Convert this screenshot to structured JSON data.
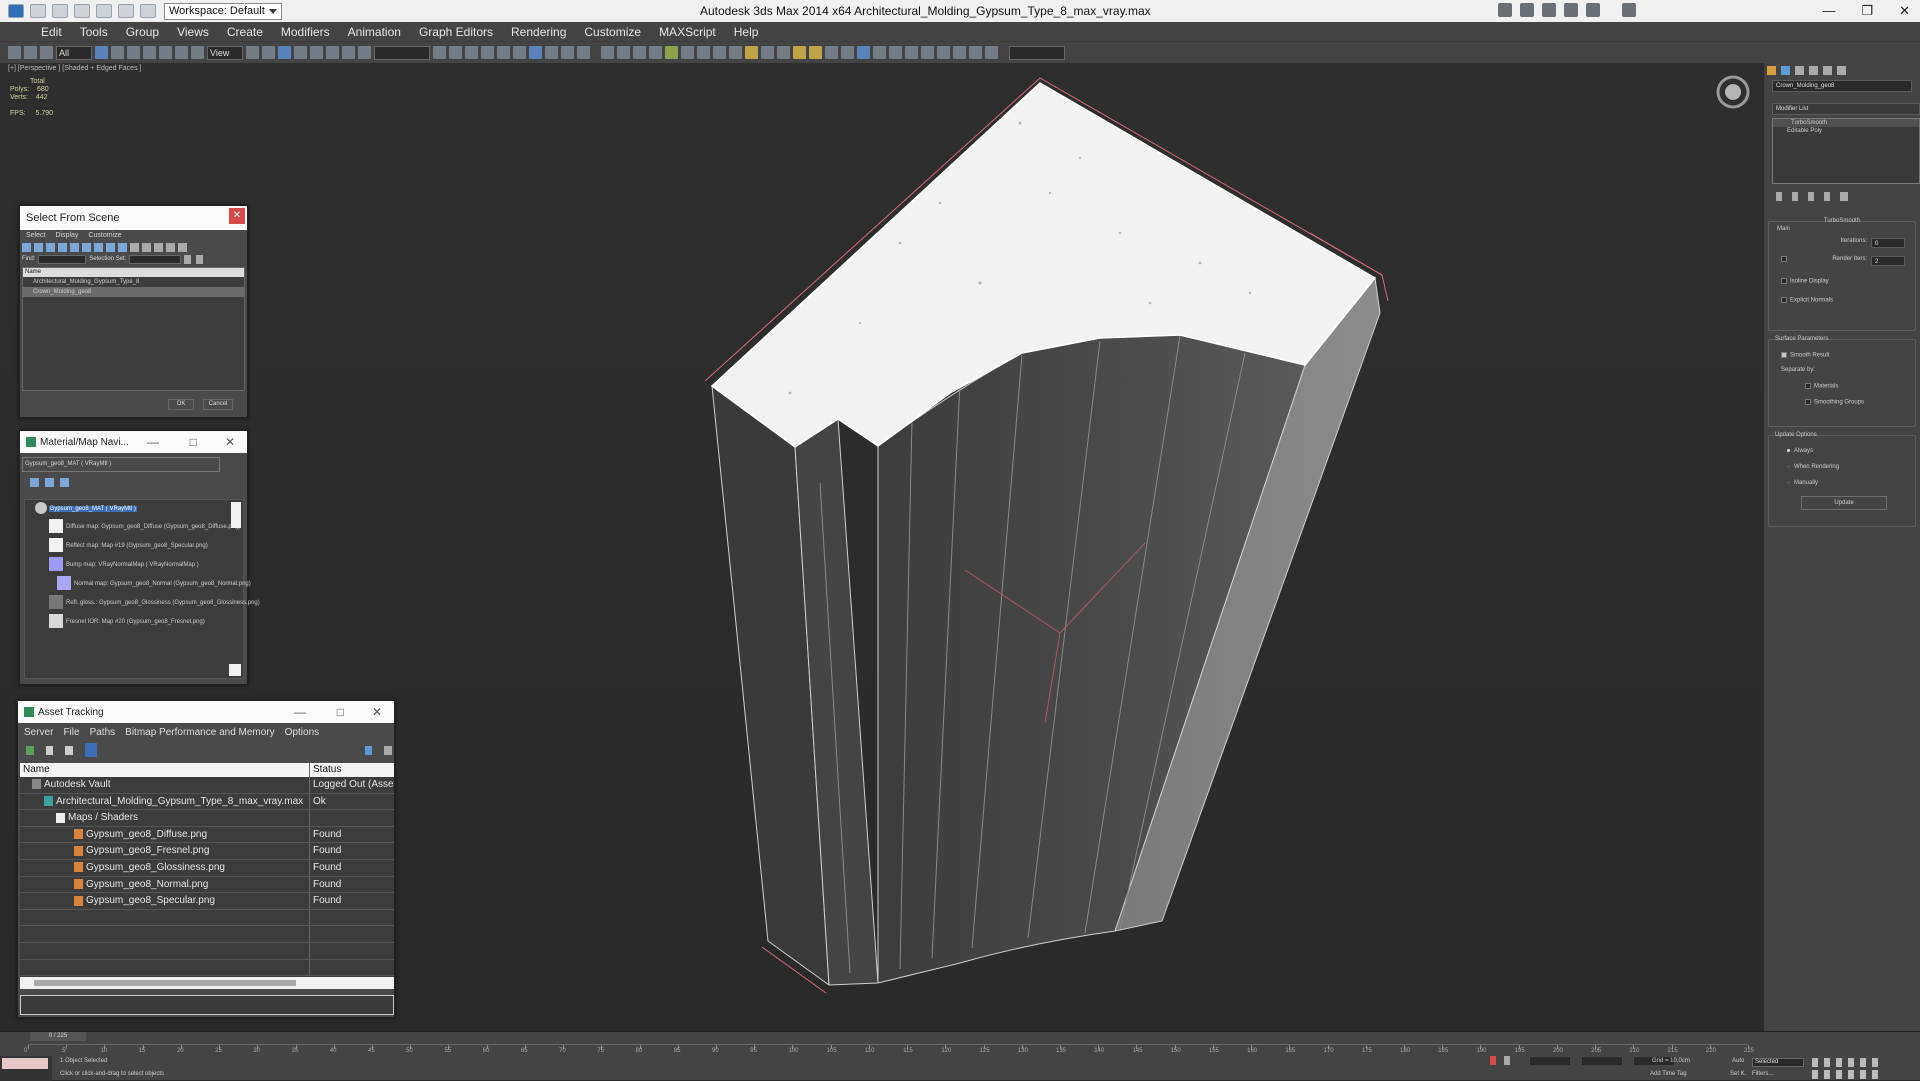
{
  "app": {
    "title": "Autodesk 3ds Max  2014 x64     Architectural_Molding_Gypsum_Type_8_max_vray.max",
    "workspace": "Workspace: Default"
  },
  "menu": [
    "Edit",
    "Tools",
    "Group",
    "Views",
    "Create",
    "Modifiers",
    "Animation",
    "Graph Editors",
    "Rendering",
    "Customize",
    "MAXScript",
    "Help"
  ],
  "toolbar": {
    "selection_filter": "All",
    "ref_coord": "View"
  },
  "viewport": {
    "label": "[+] [Perspective ] [Shaded + Edged Faces ]",
    "stats": {
      "total_label": "Total",
      "polys_label": "Polys:",
      "polys": "680",
      "verts_label": "Verts:",
      "verts": "442",
      "fps_label": "FPS:",
      "fps": "5.790"
    }
  },
  "select_from_scene": {
    "title": "Select From Scene",
    "menu": [
      "Select",
      "Display",
      "Customize"
    ],
    "find_label": "Find:",
    "selection_set_label": "Selection Set:",
    "column": "Name",
    "items": [
      "Architectural_Molding_Gypsum_Type_8",
      "Crown_Molding_geo8"
    ],
    "ok": "OK",
    "cancel": "Cancel"
  },
  "material_nav": {
    "title": "Material/Map Navi...",
    "current": "Gypsum_geo8_MAT  ( VRayMtl )",
    "items": [
      "Gypsum_geo8_MAT  ( VRayMtl )",
      "Diffuse map: Gypsum_geo8_Diffuse (Gypsum_geo8_Diffuse.png)",
      "Reflect map: Map #19 (Gypsum_geo8_Specular.png)",
      "Bump map: VRayNormalMap  ( VRayNormalMap )",
      "Normal map: Gypsum_geo8_Normal (Gypsum_geo8_Normal.png)",
      "Refl. gloss.: Gypsum_geo8_Glossiness (Gypsum_geo8_Glossiness.png)",
      "Fresnel IOR: Map #20 (Gypsum_geo8_Fresnel.png)"
    ]
  },
  "asset_tracking": {
    "title": "Asset Tracking",
    "menu": [
      "Server",
      "File",
      "Paths",
      "Bitmap Performance and Memory",
      "Options"
    ],
    "columns": [
      "Name",
      "Status"
    ],
    "rows": [
      {
        "name": "Autodesk Vault",
        "status": "Logged Out (Asset"
      },
      {
        "name": "Architectural_Molding_Gypsum_Type_8_max_vray.max",
        "status": "Ok"
      },
      {
        "name": "Maps / Shaders",
        "status": ""
      },
      {
        "name": "Gypsum_geo8_Diffuse.png",
        "status": "Found"
      },
      {
        "name": "Gypsum_geo8_Fresnel.png",
        "status": "Found"
      },
      {
        "name": "Gypsum_geo8_Glossiness.png",
        "status": "Found"
      },
      {
        "name": "Gypsum_geo8_Normal.png",
        "status": "Found"
      },
      {
        "name": "Gypsum_geo8_Specular.png",
        "status": "Found"
      }
    ]
  },
  "command_panel": {
    "object_name": "Crown_Molding_geo8",
    "modifier_list": "Modifier List",
    "stack": [
      "TurboSmooth",
      "Editable Poly"
    ],
    "rollout_title": "TurboSmooth",
    "main_label": "Main",
    "iterations_label": "Iterations:",
    "iterations": "0",
    "render_iters_label": "Render Iters:",
    "render_iters": "2",
    "isoline": "Isoline Display",
    "explicit_normals": "Explicit Normals",
    "surface_params": "Surface Parameters",
    "smooth_result": "Smooth Result",
    "separate_by": "Separate by:",
    "materials": "Materials",
    "smoothing_groups": "Smoothing Groups",
    "update_options": "Update Options",
    "always": "Always",
    "when_rendering": "When Rendering",
    "manually": "Manually",
    "update_button": "Update"
  },
  "timeline": {
    "frame": "0 / 225",
    "status1": "1 Object Selected",
    "status2": "Click or click-and-drag to select objects",
    "grid": "Grid = 10,0cm",
    "auto": "Auto",
    "set_k": "Set K.",
    "selected": "Selected",
    "filters": "Filters...",
    "add_time_tag": "Add Time Tag",
    "ticks": [
      "0",
      "5",
      "10",
      "15",
      "20",
      "25",
      "30",
      "35",
      "40",
      "45",
      "50",
      "55",
      "60",
      "65",
      "70",
      "75",
      "80",
      "85",
      "90",
      "95",
      "100",
      "105",
      "110",
      "115",
      "120",
      "125",
      "130",
      "135",
      "140",
      "145",
      "150",
      "155",
      "160",
      "165",
      "170",
      "175",
      "180",
      "185",
      "190",
      "195",
      "200",
      "205",
      "210",
      "215",
      "220",
      "225"
    ]
  },
  "colors": {
    "accent": "#5a8ecf",
    "viewport_bg": "#2f2f2f",
    "panel": "#444444"
  }
}
